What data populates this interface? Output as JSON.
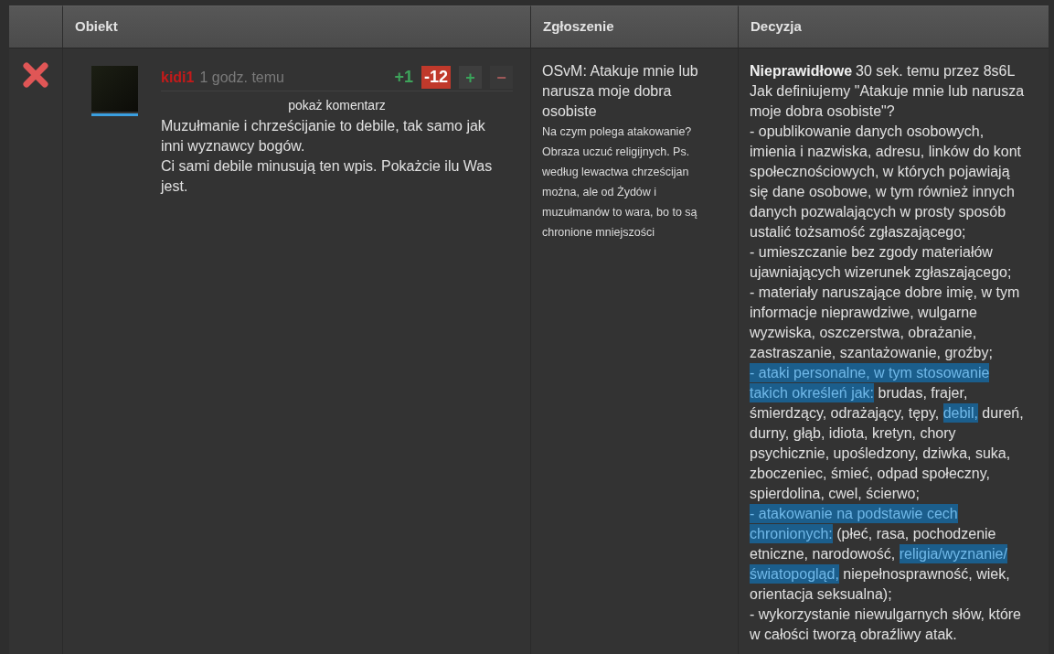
{
  "table": {
    "columns": [
      "Obiekt",
      "Zgłoszenie",
      "Decyzja"
    ],
    "rows": [
      {
        "rejected": true,
        "object": {
          "author": "kidi1",
          "time": "1 godz. temu",
          "score_up": "+1",
          "score_down": "-12",
          "vote_buttons": [
            {
              "kind": "up",
              "label": "+"
            },
            {
              "kind": "down",
              "label": "−"
            }
          ],
          "show_comment": "pokaż komentarz",
          "text": [
            "Muzułmanie i chrześcijanie to debile, tak samo jak inni wyznawcy bogów.",
            "Ci sami debile minusują ten wpis. Pokażcie ilu Was jest."
          ]
        },
        "report": {
          "reason": "OSvM: Atakuje mnie lub narusza moje dobra osobiste",
          "comment": "Na czym polega atakowanie? Obraza uczuć religijnych. Ps. według lewactwa chrześcijan można, ale od Żydów i muzułmanów to wara, bo to są chronione mniejszości"
        },
        "decision": {
          "verdict": "Nieprawidłowe",
          "meta": "30 sek. temu przez 8s6L",
          "paragraphs": [
            [
              {
                "text": "Jak definiujemy \"Atakuje mnie lub narusza moje dobra osobiste\"?",
                "highlighted": false
              }
            ],
            [
              {
                "text": "- opublikowanie danych osobowych,\nimienia i nazwiska, adresu, linków do kont społecznościowych, w których pojawiają się dane osobowe, w tym również innych danych pozwalających w prosty sposób ustalić tożsamość zgłaszającego;",
                "highlighted": false
              }
            ],
            [
              {
                "text": "- umieszczanie bez zgody materiałów ujawniających wizerunek zgłaszającego;",
                "highlighted": false
              }
            ],
            [
              {
                "text": "- materiały naruszające dobre imię, w tym informacje nieprawdziwe, wulgarne wyzwiska, oszczerstwa, obrażanie, zastraszanie, szantażowanie, groźby;",
                "highlighted": false
              }
            ],
            [
              {
                "text": "- ataki personalne, w tym stosowanie takich określeń jak:",
                "highlighted": true
              },
              {
                "text": " brudas, frajer, śmierdzący, odrażający, tępy, ",
                "highlighted": false
              },
              {
                "text": "debil,",
                "highlighted": true
              },
              {
                "text": " dureń, durny, głąb, idiota, kretyn, chory psychicznie, upośledzony, dziwka, suka, zboczeniec, śmieć, odpad społeczny, spierdolina, cwel, ścierwo;",
                "highlighted": false
              }
            ],
            [
              {
                "text": "- atakowanie na podstawie cech chronionych:",
                "highlighted": true
              },
              {
                "text": " (płeć, rasa, pochodzenie etniczne, narodowość, ",
                "highlighted": false
              },
              {
                "text": "religia/wyznanie/światopogląd,",
                "highlighted": true
              },
              {
                "text": " niepełnosprawność, wiek, orientacja seksualna);",
                "highlighted": false
              }
            ],
            [
              {
                "text": "- wykorzystanie niewulgarnych słów, które w całości tworzą obraźliwy atak.",
                "highlighted": false
              }
            ]
          ]
        }
      }
    ]
  }
}
